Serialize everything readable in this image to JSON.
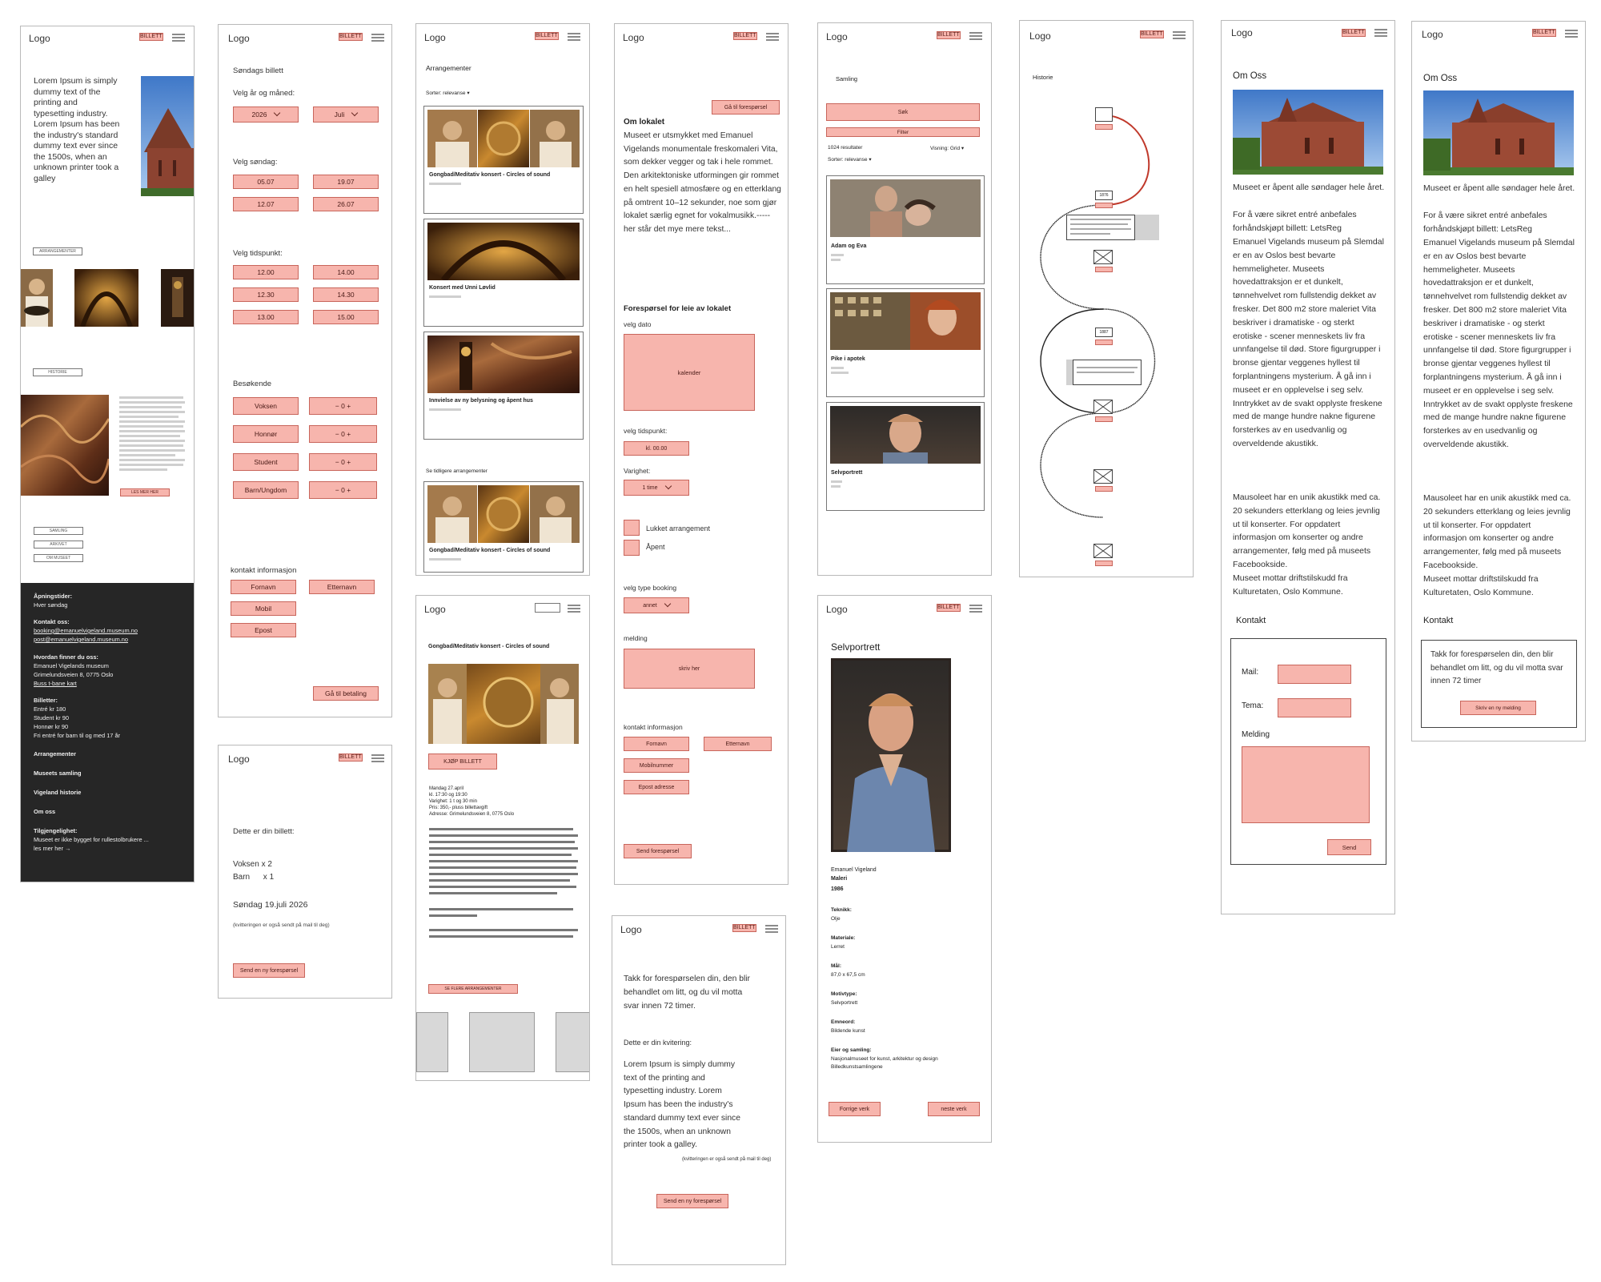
{
  "common": {
    "logo": "Logo",
    "billetter": "BILLETTER"
  },
  "f1": {
    "hero": "Lorem Ipsum is simply dummy text of the printing and typesetting industry. Lorem Ipsum has been the industry's standard dummy text ever since the 1500s, when an unknown printer took a galley",
    "btn1": "ARRANGEMENTER",
    "btn2": "HISTORIE",
    "btn3": "LES MER HER",
    "mini1": "SAMLING",
    "mini2": "ARKIVET",
    "mini3": "OM MUSEET",
    "footer": {
      "h1": "Åpningstider:",
      "l1": "Hver søndag",
      "h2": "Kontakt oss:",
      "l2a": "booking@emanuelvigeland.museum.no",
      "l2b": "post@emanuelvigeland.museum.no",
      "h3": "Hvordan finner du oss:",
      "l3a": "Emanuel Vigelands museum",
      "l3b": "Grimelundsveien 8, 0775 Oslo",
      "l3c": "Buss   t-bane   kart",
      "h4": "Billetter:",
      "l4a": "Entré kr 180",
      "l4b": "Student kr 90",
      "l4c": "Honnør kr 90",
      "l4d": "Fri entré for barn til og med 17 år",
      "n1": "Arrangementer",
      "n2": "Museets samling",
      "n3": "Vigeland historie",
      "n4": "Om oss",
      "h5": "Tilgjengelighet:",
      "l5": "Museet er ikke bygget for rullestolbrukere ...",
      "l5b": "les mer her →"
    }
  },
  "f2": {
    "title": "Søndags billett",
    "ym": "Velg år og måned:",
    "year": "2026",
    "month": "Juli",
    "sun": "Velg søndag:",
    "d1": "05.07",
    "d2": "19.07",
    "d3": "12.07",
    "d4": "26.07",
    "time": "Velg tidspunkt:",
    "t1": "12.00",
    "t2": "14.00",
    "t3": "12.30",
    "t4": "14.30",
    "t5": "13.00",
    "t6": "15.00",
    "visitors": "Besøkende",
    "v1": "Voksen",
    "v2": "Honnør",
    "v3": "Student",
    "v4": "Barn/Ungdom",
    "cnt": "−  0  +",
    "contact": "kontakt informasjon",
    "first": "Fornavn",
    "last": "Etternavn",
    "mobil": "Mobil",
    "epost": "Epost",
    "pay": "Gå til betaling"
  },
  "f2b": {
    "intro": "Dette er din billett:",
    "l1": "Voksen x 2",
    "l2": "Barn      x 1",
    "date": "Søndag 19.juli 2026",
    "note": "(kvitteringen er også sendt på mail til deg)",
    "btn": "Send en ny forespørsel"
  },
  "f3": {
    "title": "Arrangementer",
    "sort": "Sorter: relevanse",
    "e1": "Gongbad/Meditativ konsert - Circles of sound",
    "e2": "Konsert med Unni Løvlid",
    "e3": "Innvielse av ny belysning og åpent hus",
    "prev": "Se tidligere arrangementer",
    "e4": "Gongbad/Meditativ konsert - Circles of sound"
  },
  "f3b": {
    "title": "Gongbad/Meditativ konsert - Circles of sound",
    "buy": "KJØP BILLETT",
    "i1": "Mandag 27.april",
    "i2": "kl. 17:30 og 19:30",
    "i3": "Varighet: 1 t og 30 min",
    "i4": "Pris: 350,- pluss billettavgift",
    "i5": "Adresse: Grimelundsveien 8, 0775 Oslo",
    "more": "SE FLERE ARRANGEMENTER"
  },
  "f4": {
    "req": "Gå til forespørsel",
    "about": "Om lokalet",
    "text": "Museet er utsmykket med Emanuel Vigelands monumentale freskomaleri Vita, som dekker vegger og tak i hele rommet. Den arkitektoniske utformingen gir rommet en helt spesiell atmosfære og en etterklang på omtrent 10–12 sekunder, noe som gjør lokalet særlig egnet for vokalmusikk.----- her står det mye mere tekst...",
    "rent": "Forespørsel for leie av lokalet",
    "date": "velg dato",
    "cal": "kalender",
    "time": "velg tidspunkt:",
    "kl": "kl. 00.00",
    "dur": "Varighet:",
    "dur1": "1 time",
    "closed": "Lukket arrangement",
    "open": "Åpent",
    "type": "velg type booking",
    "type1": "annet",
    "msg": "melding",
    "write": "skriv her",
    "contact": "kontakt informasjon",
    "first": "Fornavn",
    "last": "Etternavn",
    "mobil": "Mobilnummer",
    "epost": "Epost adresse",
    "send": "Send forespørsel"
  },
  "f4b": {
    "thanks": "Takk for forespørselen din, den blir behandlet om litt, og du vil motta svar innen 72 timer.",
    "rec": "Dette er din kvitering:",
    "lorem": "Lorem Ipsum is simply dummy text of the printing and typesetting industry. Lorem Ipsum has been the industry's standard dummy text ever since the 1500s, when an unknown printer took a galley.",
    "note": "(kvitteringen er også sendt på mail til deg)",
    "btn": "Send en ny forespørsel"
  },
  "f5": {
    "title": "Samling",
    "search": "Søk",
    "filter": "Filter",
    "results": "1024 resultater",
    "view": "Visning: Grid",
    "sort": "Sorter: relevanse",
    "w1": "Adam og Eva",
    "w2": "Pike i apotek",
    "w3": "Selvportrett"
  },
  "f5b": {
    "title": "Selvportrett",
    "artist": "Emanuel Vigeland",
    "kind": "Maleri",
    "year": "1986",
    "h1": "Teknikk:",
    "v1": "Olje",
    "h2": "Materiale:",
    "v2": "Lerret",
    "h3": "Mål:",
    "v3": "87,0 x 67,5 cm",
    "h4": "Motivtype:",
    "v4": "Selvportrett",
    "h5": "Emneord:",
    "v5": "Bildende kunst",
    "h6": "Eier og samling:",
    "v6a": "Nasjonalmuseet for kunst, arkitektur og design",
    "v6b": "Billedkunstsamlingene",
    "prev": "Forrige verk",
    "next": "neste verk"
  },
  "f6": {
    "title": "Historie",
    "y1": "1876",
    "y2": "1887"
  },
  "f7": {
    "title": "Om Oss",
    "p1": "Museet er åpent alle søndager hele året.",
    "p2": "For å være sikret entré anbefales forhåndskjøpt billett: LetsReg",
    "p3": "Emanuel Vigelands museum på Slemdal er en av Oslos best bevarte hemmeligheter. Museets hovedattraksjon er et dunkelt, tønnehvelvet rom fullstendig dekket av fresker. Det 800 m2 store maleriet Vita beskriver i dramatiske - og sterkt erotiske - scener menneskets liv fra unnfangelse til død. Store figurgrupper i bronse gjentar veggenes hyllest til forplantningens mysterium. Å gå inn i museet er en opplevelse i seg selv. Inntrykket av de svakt opplyste freskene med de mange hundre nakne figurene forsterkes av en usedvanlig og overveldende akustikk.",
    "p4": "Mausoleet har en unik akustikk med ca. 20 sekunders etterklang og leies jevnlig ut til konserter. For oppdatert informasjon om konserter og andre arrangementer, følg med på museets Facebookside.",
    "p5": "Museet mottar driftstilskudd fra Kulturetaten, Oslo Kommune.",
    "contact": "Kontakt",
    "mail": "Mail:",
    "tema": "Tema:",
    "msg": "Melding",
    "send": "Send"
  },
  "f8": {
    "thanks": "Takk for forespørselen din, den blir behandlet om litt, og du vil motta svar innen 72 timer",
    "btn": "Skriv en ny melding"
  }
}
